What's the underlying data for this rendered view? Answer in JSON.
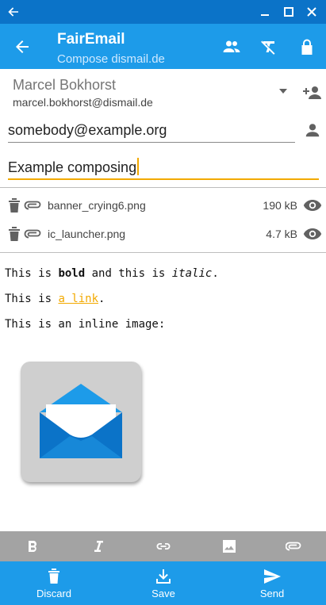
{
  "app": {
    "title": "FairEmail",
    "subtitle": "Compose dismail.de"
  },
  "identity": {
    "name": "Marcel Bokhorst",
    "email": "marcel.bokhorst@dismail.de"
  },
  "compose": {
    "to": "somebody@example.org",
    "subject": "Example composing"
  },
  "attachments": [
    {
      "name": "banner_crying6.png",
      "size": "190 kB"
    },
    {
      "name": "ic_launcher.png",
      "size": "4.7 kB"
    }
  ],
  "body": {
    "line1_a": "This is ",
    "line1_bold": "bold",
    "line1_b": " and this is ",
    "line1_italic": "italic",
    "line1_c": ".",
    "line2_a": "This is ",
    "line2_link": "a link",
    "line2_b": ".",
    "line3": "This is an inline image:"
  },
  "bottom": {
    "discard": "Discard",
    "save": "Save",
    "send": "Send"
  },
  "colors": {
    "appbar": "#1d9be9",
    "windowbar": "#0b73c8",
    "accent": "#f2a900",
    "format_bar": "#a3a3a3"
  },
  "icons": {
    "nav": "arrow-left-icon",
    "contacts": "people-icon",
    "clear_formatting": "clear-format-icon",
    "lock": "lock-icon",
    "attachment_delete": "trash-icon",
    "attachment_type": "paperclip-icon",
    "attachment_view": "eye-icon"
  }
}
